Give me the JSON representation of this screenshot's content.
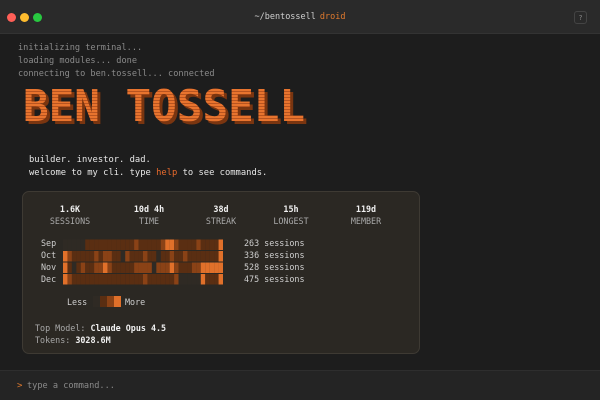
{
  "window": {
    "title_path": "~/bentossell",
    "title_app": "droid",
    "help_label": "?"
  },
  "boot_log": [
    "initializing terminal...",
    "loading modules... done",
    "connecting to ben.tossell... connected"
  ],
  "banner": {
    "text": "BEN TOSSELL",
    "fill_color": "#e8742e",
    "shadow_color": "#8a3d14"
  },
  "intro": {
    "line1": "builder. investor. dad.",
    "line2_before": "welcome to my cli. type ",
    "line2_command": "help",
    "line2_after": " to see commands."
  },
  "stats": [
    {
      "value": "1.6K",
      "label": "SESSIONS"
    },
    {
      "value": "10d 4h",
      "label": "TIME"
    },
    {
      "value": "38d",
      "label": "STREAK"
    },
    {
      "value": "15h",
      "label": "LONGEST"
    },
    {
      "value": "119d",
      "label": "MEMBER"
    }
  ],
  "activity": [
    {
      "month": "Sep",
      "sessions": "263 sessions"
    },
    {
      "month": "Oct",
      "sessions": "336 sessions"
    },
    {
      "month": "Nov",
      "sessions": "528 sessions"
    },
    {
      "month": "Dec",
      "sessions": "475 sessions"
    }
  ],
  "heatmap_levels": [
    [
      0,
      0,
      0,
      0,
      0,
      1,
      1,
      1,
      1,
      1,
      1,
      1,
      1,
      1,
      1,
      1,
      2,
      1,
      1,
      1,
      1,
      1,
      2,
      3,
      3,
      2,
      1,
      1,
      1,
      1,
      2,
      1,
      1,
      1,
      1,
      3
    ],
    [
      3,
      2,
      1,
      1,
      1,
      1,
      1,
      2,
      1,
      2,
      2,
      1,
      1,
      0,
      2,
      1,
      1,
      1,
      2,
      1,
      1,
      0,
      1,
      1,
      2,
      1,
      1,
      2,
      1,
      1,
      1,
      1,
      1,
      1,
      1,
      3
    ],
    [
      3,
      1,
      0,
      1,
      2,
      1,
      1,
      2,
      2,
      3,
      2,
      1,
      1,
      1,
      1,
      1,
      2,
      2,
      2,
      2,
      0,
      2,
      2,
      2,
      3,
      2,
      1,
      1,
      1,
      2,
      2,
      3,
      3,
      3,
      3,
      3
    ],
    [
      3,
      2,
      1,
      1,
      1,
      1,
      1,
      1,
      1,
      1,
      1,
      1,
      1,
      1,
      1,
      1,
      1,
      1,
      2,
      1,
      1,
      1,
      1,
      1,
      1,
      2,
      0,
      0,
      0,
      0,
      0,
      3,
      1,
      1,
      1,
      3
    ]
  ],
  "heatmap_colors": [
    "#2f2a24",
    "#5a2e12",
    "#8a4216",
    "#e0702a"
  ],
  "legend": {
    "less": "Less",
    "more": "More"
  },
  "top_model": {
    "label": "Top Model:",
    "value": "Claude Opus 4.5"
  },
  "tokens": {
    "label": "Tokens:",
    "value": "3028.6M"
  },
  "prompt": {
    "caret": ">",
    "placeholder": "type a command..."
  }
}
